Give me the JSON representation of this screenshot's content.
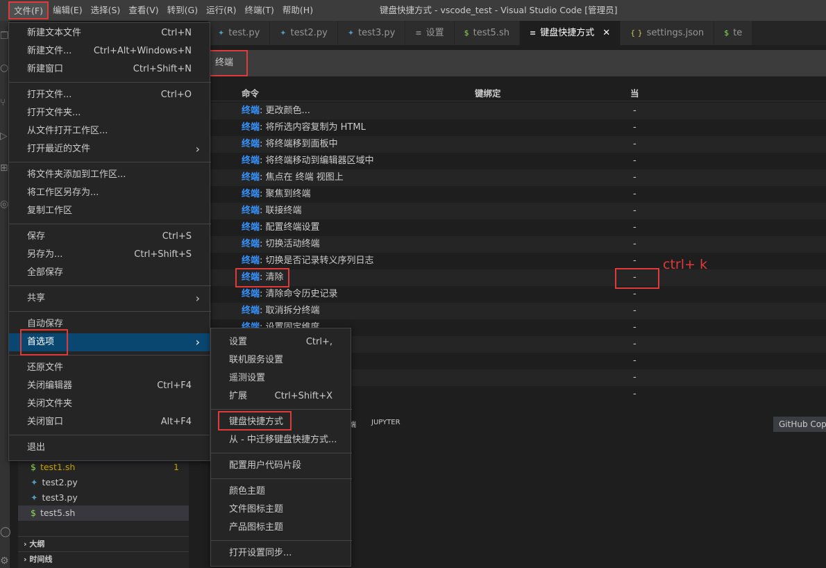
{
  "titlebar": {
    "menus": [
      "文件(F)",
      "编辑(E)",
      "选择(S)",
      "查看(V)",
      "转到(G)",
      "运行(R)",
      "终端(T)",
      "帮助(H)"
    ],
    "title": "键盘快捷方式 - vscode_test - Visual Studio Code [管理员]"
  },
  "tabs": [
    {
      "label": "test.py",
      "icon": "python-icon"
    },
    {
      "label": "test2.py",
      "icon": "python-icon"
    },
    {
      "label": "test3.py",
      "icon": "python-icon"
    },
    {
      "label": "设置",
      "icon": "settings-doc-icon"
    },
    {
      "label": "test5.sh",
      "icon": "shell-icon"
    },
    {
      "label": "键盘快捷方式",
      "icon": "keyboard-doc-icon",
      "active": true
    },
    {
      "label": "settings.json",
      "icon": "json-icon"
    },
    {
      "label": "te",
      "icon": "shell-icon"
    }
  ],
  "keybindings": {
    "search": "终端",
    "columns": {
      "command": "命令",
      "keybinding": "键绑定",
      "when": "当"
    },
    "prefix": "终端",
    "rows": [
      {
        "cmd": ": 更改颜色...",
        "when": "-"
      },
      {
        "cmd": ": 将所选内容复制为 HTML",
        "when": "-"
      },
      {
        "cmd": ": 将终端移到面板中",
        "when": "-"
      },
      {
        "cmd": ": 将终端移动到编辑器区域中",
        "when": "-"
      },
      {
        "cmd": ": 焦点在 终端 视图上",
        "when": "-"
      },
      {
        "cmd": ": 聚焦到终端",
        "when": "-"
      },
      {
        "cmd": ": 联接终端",
        "when": "-"
      },
      {
        "cmd": ": 配置终端设置",
        "when": "-"
      },
      {
        "cmd": ": 切换活动终端",
        "when": "-"
      },
      {
        "cmd": ": 切换是否记录转义序列日志",
        "when": "-"
      },
      {
        "cmd": ": 清除",
        "when": "-"
      },
      {
        "cmd": ": 清除命令历史记录",
        "when": "-"
      },
      {
        "cmd": ": 取消拆分终端",
        "when": "-"
      },
      {
        "cmd": ": 设置固定维度",
        "when": "-"
      },
      {
        "cmd": "",
        "when": "-"
      },
      {
        "cmd": "",
        "when": "-"
      },
      {
        "cmd": "",
        "when": "-"
      },
      {
        "cmd": "",
        "when": "-"
      }
    ],
    "annotation": "ctrl+ k"
  },
  "panel": {
    "tab_partial": "端",
    "jupyter": "JUPYTER",
    "copilot": "GitHub Cop"
  },
  "sidebar": {
    "files": [
      {
        "name": "test1.sh",
        "icon": "shell-icon",
        "badge": "1"
      },
      {
        "name": "test2.py",
        "icon": "python-icon"
      },
      {
        "name": "test3.py",
        "icon": "python-icon"
      },
      {
        "name": "test5.sh",
        "icon": "shell-icon",
        "selected": true
      }
    ],
    "sections": [
      "大纲",
      "时间线"
    ]
  },
  "file_menu": [
    {
      "label": "新建文本文件",
      "shortcut": "Ctrl+N"
    },
    {
      "label": "新建文件...",
      "shortcut": "Ctrl+Alt+Windows+N"
    },
    {
      "label": "新建窗口",
      "shortcut": "Ctrl+Shift+N"
    },
    {
      "sep": true
    },
    {
      "label": "打开文件...",
      "shortcut": "Ctrl+O"
    },
    {
      "label": "打开文件夹...",
      "shortcut": ""
    },
    {
      "label": "从文件打开工作区...",
      "shortcut": ""
    },
    {
      "label": "打开最近的文件",
      "shortcut": "",
      "submenu": true
    },
    {
      "sep": true
    },
    {
      "label": "将文件夹添加到工作区...",
      "shortcut": ""
    },
    {
      "label": "将工作区另存为...",
      "shortcut": ""
    },
    {
      "label": "复制工作区",
      "shortcut": ""
    },
    {
      "sep": true
    },
    {
      "label": "保存",
      "shortcut": "Ctrl+S"
    },
    {
      "label": "另存为...",
      "shortcut": "Ctrl+Shift+S"
    },
    {
      "label": "全部保存",
      "shortcut": ""
    },
    {
      "sep": true
    },
    {
      "label": "共享",
      "shortcut": "",
      "submenu": true
    },
    {
      "sep": true
    },
    {
      "label": "自动保存",
      "shortcut": ""
    },
    {
      "label": "首选项",
      "shortcut": "",
      "submenu": true,
      "highlight": true
    },
    {
      "sep": true
    },
    {
      "label": "还原文件",
      "shortcut": ""
    },
    {
      "label": "关闭编辑器",
      "shortcut": "Ctrl+F4"
    },
    {
      "label": "关闭文件夹",
      "shortcut": ""
    },
    {
      "label": "关闭窗口",
      "shortcut": "Alt+F4"
    },
    {
      "sep": true
    },
    {
      "label": "退出",
      "shortcut": ""
    }
  ],
  "pref_menu": [
    {
      "label": "设置",
      "shortcut": "Ctrl+,"
    },
    {
      "label": "联机服务设置",
      "shortcut": ""
    },
    {
      "label": "遥测设置",
      "shortcut": ""
    },
    {
      "label": "扩展",
      "shortcut": "Ctrl+Shift+X"
    },
    {
      "sep": true
    },
    {
      "label": "键盘快捷方式",
      "shortcut": ""
    },
    {
      "label": "从 - 中迁移键盘快捷方式...",
      "shortcut": ""
    },
    {
      "sep": true
    },
    {
      "label": "配置用户代码片段",
      "shortcut": ""
    },
    {
      "sep": true
    },
    {
      "label": "颜色主题",
      "shortcut": ""
    },
    {
      "label": "文件图标主题",
      "shortcut": ""
    },
    {
      "label": "产品图标主题",
      "shortcut": ""
    },
    {
      "sep": true
    },
    {
      "label": "打开设置同步...",
      "shortcut": ""
    }
  ],
  "colors": {
    "accent": "#094771",
    "highlight_box": "#e03b3b",
    "command_prefix": "#3794ff"
  }
}
